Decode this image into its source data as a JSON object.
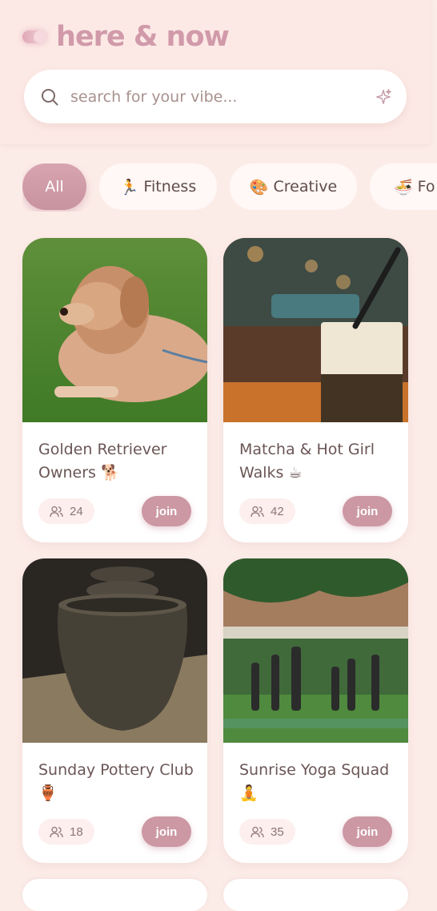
{
  "app": {
    "name": "here & now",
    "search_placeholder": "search for your vibe..."
  },
  "categories": [
    {
      "label": "All",
      "emoji": "",
      "active": true
    },
    {
      "label": "Fitness",
      "emoji": "🏃",
      "active": false
    },
    {
      "label": "Creative",
      "emoji": "🎨",
      "active": false
    },
    {
      "label": "Fo",
      "emoji": "🍜",
      "active": false
    }
  ],
  "groups": [
    {
      "title": "Golden Retriever Owners 🐕",
      "members": "24",
      "join_label": "join",
      "image": "golden-retriever-photo"
    },
    {
      "title": "Matcha & Hot Girl Walks ☕",
      "members": "42",
      "join_label": "join",
      "image": "matcha-drink-photo"
    },
    {
      "title": "Sunday Pottery Club 🏺",
      "members": "18",
      "join_label": "join",
      "image": "pottery-vase-photo"
    },
    {
      "title": "Sunrise Yoga Squad 🧘",
      "members": "35",
      "join_label": "join",
      "image": "yoga-group-photo"
    }
  ],
  "colors": {
    "background": "#fcece8",
    "accent": "#cc98a3",
    "logo": "#d19aaa",
    "text": "#6b5656"
  }
}
